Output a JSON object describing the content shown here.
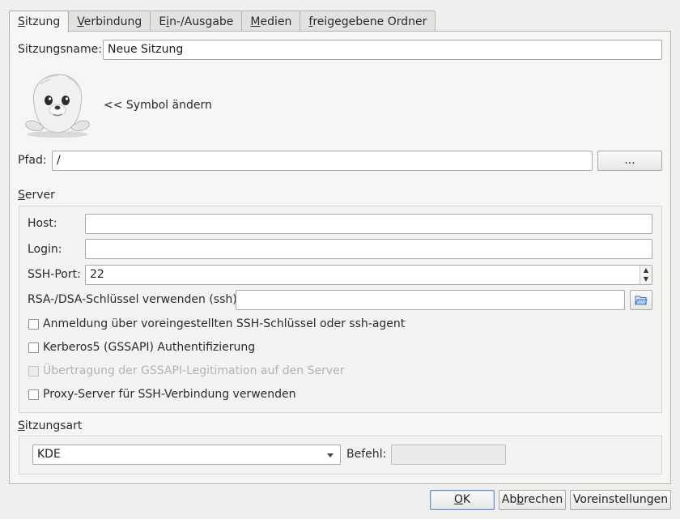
{
  "tabs": [
    {
      "pre": "",
      "u": "S",
      "post": "itzung"
    },
    {
      "pre": "",
      "u": "V",
      "post": "erbindung"
    },
    {
      "pre": "E",
      "u": "i",
      "post": "n-/Ausgabe"
    },
    {
      "pre": "",
      "u": "M",
      "post": "edien"
    },
    {
      "pre": "",
      "u": "f",
      "post": "reigegebene Ordner"
    }
  ],
  "session": {
    "name_label": "Sitzungsname:",
    "name_value": "Neue Sitzung",
    "icon_label": "<< Symbol ändern",
    "path_label": "Pfad:",
    "path_value": "/",
    "browse_label": "..."
  },
  "server": {
    "title_u": "S",
    "title_rest": "erver",
    "host_label": "Host:",
    "host_value": "",
    "login_label": "Login:",
    "login_value": "",
    "port_label": "SSH-Port:",
    "port_value": "22",
    "key_label": "RSA-/DSA-Schlüssel verwenden (ssh):",
    "key_value": "",
    "opt1": "Anmeldung über voreingestellten SSH-Schlüssel oder ssh-agent",
    "opt2": "Kerberos5 (GSSAPI) Authentifizierung",
    "opt3": "Übertragung der GSSAPI-Legitimation auf den Server",
    "opt4": "Proxy-Server für SSH-Verbindung verwenden"
  },
  "session_type": {
    "title_u": "S",
    "title_rest": "itzungsart",
    "selected": "KDE",
    "command_label": "Befehl:",
    "command_value": ""
  },
  "buttons": {
    "ok_u": "O",
    "ok_rest": "K",
    "cancel_pre": "Ab",
    "cancel_u": "b",
    "cancel_rest": "rechen",
    "defaults": "Voreinstellungen"
  }
}
